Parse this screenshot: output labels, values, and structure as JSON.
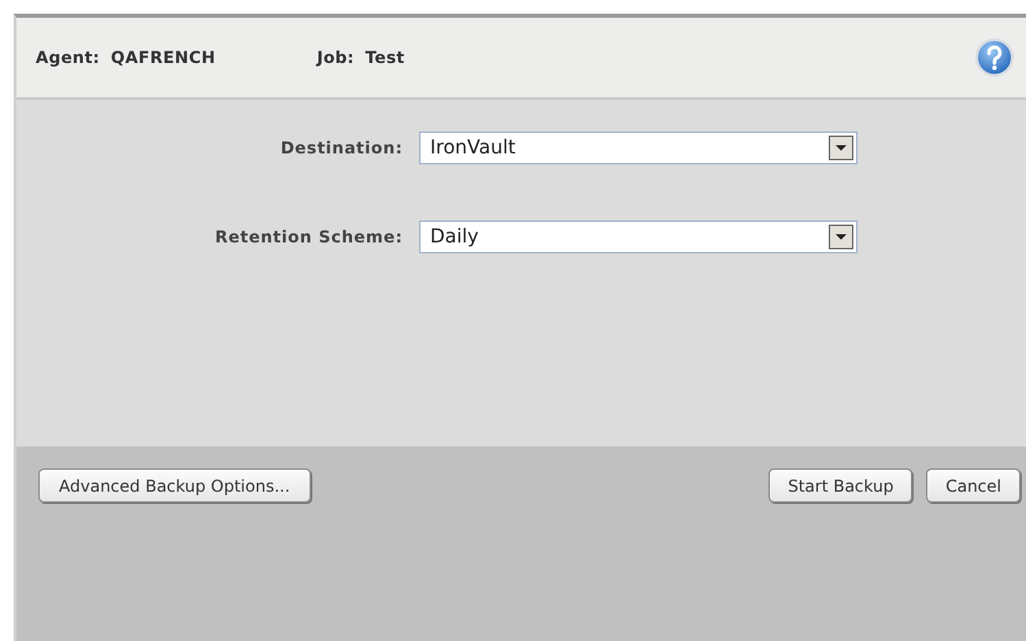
{
  "header": {
    "agent_label": "Agent:",
    "agent": "QAFRENCH",
    "job_label": "Job:",
    "job": "Test"
  },
  "fields": [
    {
      "label": "Destination:",
      "value": "IronVault"
    },
    {
      "label": "Retention Scheme:",
      "value": "Daily"
    }
  ],
  "footer": {
    "left_buttons": [
      "Advanced Backup Options..."
    ],
    "right_buttons": [
      "Start Backup",
      "Cancel"
    ]
  }
}
